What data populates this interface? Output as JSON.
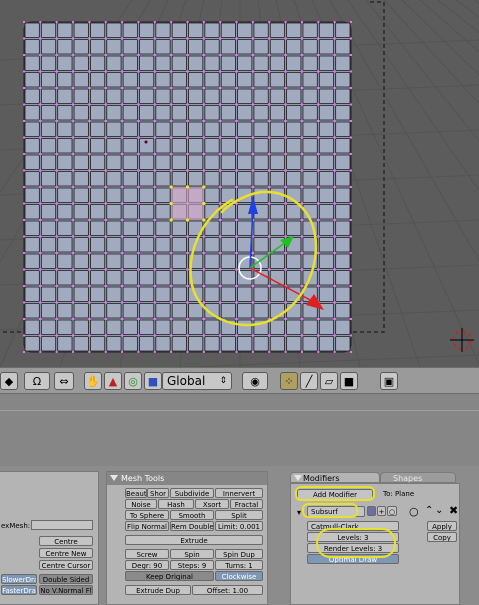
{
  "colors": {
    "viewport_bg": "#5c5c5c",
    "mesh_face": "#9098ae",
    "mesh_edge": "#000000",
    "mesh_vertex": "#ff66ff",
    "annotation": "#e8e02a",
    "axis_x": "#e02020",
    "axis_y": "#20c020",
    "axis_z": "#2040e0"
  },
  "toolbar": {
    "orientation": "Global",
    "icons": [
      "mesh-icon",
      "magnet-icon",
      "scale-icon",
      "hand-icon",
      "rotate-icon",
      "ring-icon",
      "square-icon",
      "pivot-icon",
      "vertex-select-icon",
      "edge-select-icon",
      "face-select-icon",
      "render-icon"
    ]
  },
  "left_panel": {
    "mesh_label": "exMesh:",
    "centre": "Centre",
    "centre_new": "Centre New",
    "centre_cursor": "Centre Cursor",
    "slower_draw": "SlowerDra",
    "faster_draw": "FasterDra",
    "double_sided": "Double Sided",
    "no_vnormal_flip": "No V.Normal Fl"
  },
  "mesh_tools": {
    "title": "Mesh Tools",
    "beauty": "Beaut",
    "short": "Shor",
    "subdivide": "Subdivide",
    "innervert": "Innervert",
    "noise": "Noise",
    "hash": "Hash",
    "xsort": "Xsort",
    "fractal": "Fractal",
    "to_sphere": "To Sphere",
    "smooth": "Smooth",
    "split": "Split",
    "flip_normal": "Flip Normal",
    "rem_double": "Rem Double",
    "limit": "Limit: 0.001",
    "extrude": "Extrude",
    "screw": "Screw",
    "spin": "Spin",
    "spin_dup": "Spin Dup",
    "degr": "Degr: 90",
    "steps": "Steps: 9",
    "turns": "Turns: 1",
    "keep_original": "Keep Original",
    "clockwise": "Clockwise",
    "extrude_dup": "Extrude Dup",
    "offset": "Offset: 1.00"
  },
  "modifiers": {
    "tab_modifiers": "Modifiers",
    "tab_shapes": "Shapes",
    "add_modifier": "Add Modifier",
    "to_label": "To: Plane",
    "subsurf": "Subsurf",
    "catmull": "Catmull-Clark",
    "levels": "Levels: 3",
    "render_levels": "Render Levels: 3",
    "optimal_draw": "Optimal Draw",
    "apply": "Apply",
    "copy": "Copy"
  }
}
